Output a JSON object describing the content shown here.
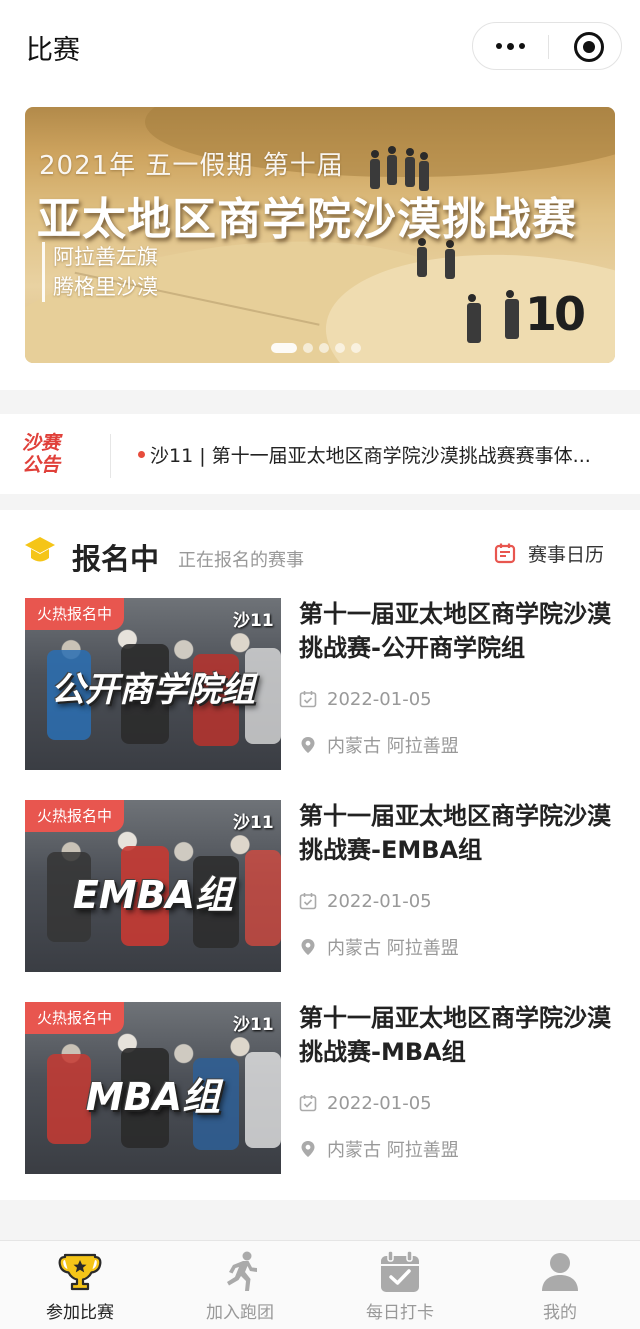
{
  "header": {
    "title": "比赛",
    "more_icon": "more-dots-icon",
    "close_icon": "mini-program-close-icon"
  },
  "banner": {
    "year_line": "2021年 五一假期 第十届",
    "title": "亚太地区商学院沙漠挑战赛",
    "location_line1": "阿拉善左旗",
    "location_line2": "腾格里沙漠",
    "logo_text": "10",
    "slides": 5,
    "active_slide": 1
  },
  "notice": {
    "logo_text": "沙赛公告",
    "text": "沙11 | 第十一届亚太地区商学院沙漠挑战赛赛事体..."
  },
  "section": {
    "title": "报名中",
    "subtitle": "正在报名的赛事",
    "calendar_label": "赛事日历"
  },
  "events": [
    {
      "badge": "火热报名中",
      "image_group_text": "公开商学院组",
      "image_brand": "沙11",
      "title": "第十一届亚太地区商学院沙漠挑战赛-公开商学院组",
      "date": "2022-01-05",
      "location": "内蒙古 阿拉善盟"
    },
    {
      "badge": "火热报名中",
      "image_group_text": "EMBA组",
      "image_brand": "沙11",
      "title": "第十一届亚太地区商学院沙漠挑战赛-EMBA组",
      "date": "2022-01-05",
      "location": "内蒙古 阿拉善盟"
    },
    {
      "badge": "火热报名中",
      "image_group_text": "MBA组",
      "image_brand": "沙11",
      "title": "第十一届亚太地区商学院沙漠挑战赛-MBA组",
      "date": "2022-01-05",
      "location": "内蒙古 阿拉善盟"
    }
  ],
  "tabbar": {
    "active": 0,
    "items": [
      {
        "label": "参加比赛",
        "icon": "trophy-icon"
      },
      {
        "label": "加入跑团",
        "icon": "runner-icon"
      },
      {
        "label": "每日打卡",
        "icon": "calendar-check-icon"
      },
      {
        "label": "我的",
        "icon": "user-icon"
      }
    ]
  },
  "colors": {
    "accent_red": "#e8564f",
    "badge_red": "#e8564f",
    "gold": "#f5c518",
    "text_primary": "#222222",
    "text_secondary": "#999999"
  }
}
